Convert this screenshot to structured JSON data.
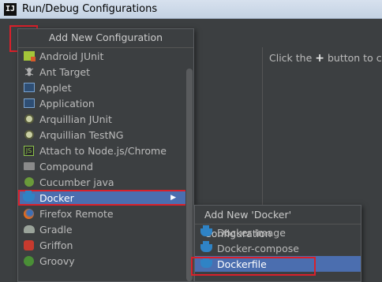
{
  "window": {
    "title": "Run/Debug Configurations",
    "app_icon": "IJ"
  },
  "toolbar": {
    "add_label": "+",
    "remove_label": "−",
    "copy_label": "⧉",
    "edit_label": "🔧",
    "up_label": "▲",
    "down_label": "▼",
    "folder_label": "▣",
    "sort_label": "⇅"
  },
  "right_panel": {
    "hint_before": "Click the",
    "hint_plus": "+",
    "hint_after": "button to cre"
  },
  "add_popup": {
    "header": "Add New Configuration",
    "items": [
      {
        "label": "Android JUnit",
        "icon": "android-junit-icon"
      },
      {
        "label": "Ant Target",
        "icon": "ant-icon"
      },
      {
        "label": "Applet",
        "icon": "applet-icon"
      },
      {
        "label": "Application",
        "icon": "application-icon"
      },
      {
        "label": "Arquillian JUnit",
        "icon": "arquillian-icon"
      },
      {
        "label": "Arquillian TestNG",
        "icon": "arquillian-icon"
      },
      {
        "label": "Attach to Node.js/Chrome",
        "icon": "nodejs-icon"
      },
      {
        "label": "Compound",
        "icon": "folder-icon"
      },
      {
        "label": "Cucumber java",
        "icon": "cucumber-icon"
      },
      {
        "label": "Docker",
        "icon": "docker-icon"
      },
      {
        "label": "Firefox Remote",
        "icon": "firefox-icon"
      },
      {
        "label": "Gradle",
        "icon": "gradle-icon"
      },
      {
        "label": "Griffon",
        "icon": "griffon-icon"
      },
      {
        "label": "Groovy",
        "icon": "groovy-icon"
      }
    ]
  },
  "docker_popup": {
    "header": "Add New 'Docker' Configuration",
    "items": [
      {
        "label": "Docker Image",
        "icon": "docker-icon"
      },
      {
        "label": "Docker-compose",
        "icon": "docker-icon"
      },
      {
        "label": "Dockerfile",
        "icon": "docker-icon"
      }
    ]
  },
  "colors": {
    "background": "#3c3f41",
    "selection": "#4b6eaf",
    "highlight_border": "#d9202a",
    "text": "#bbbbbb"
  }
}
